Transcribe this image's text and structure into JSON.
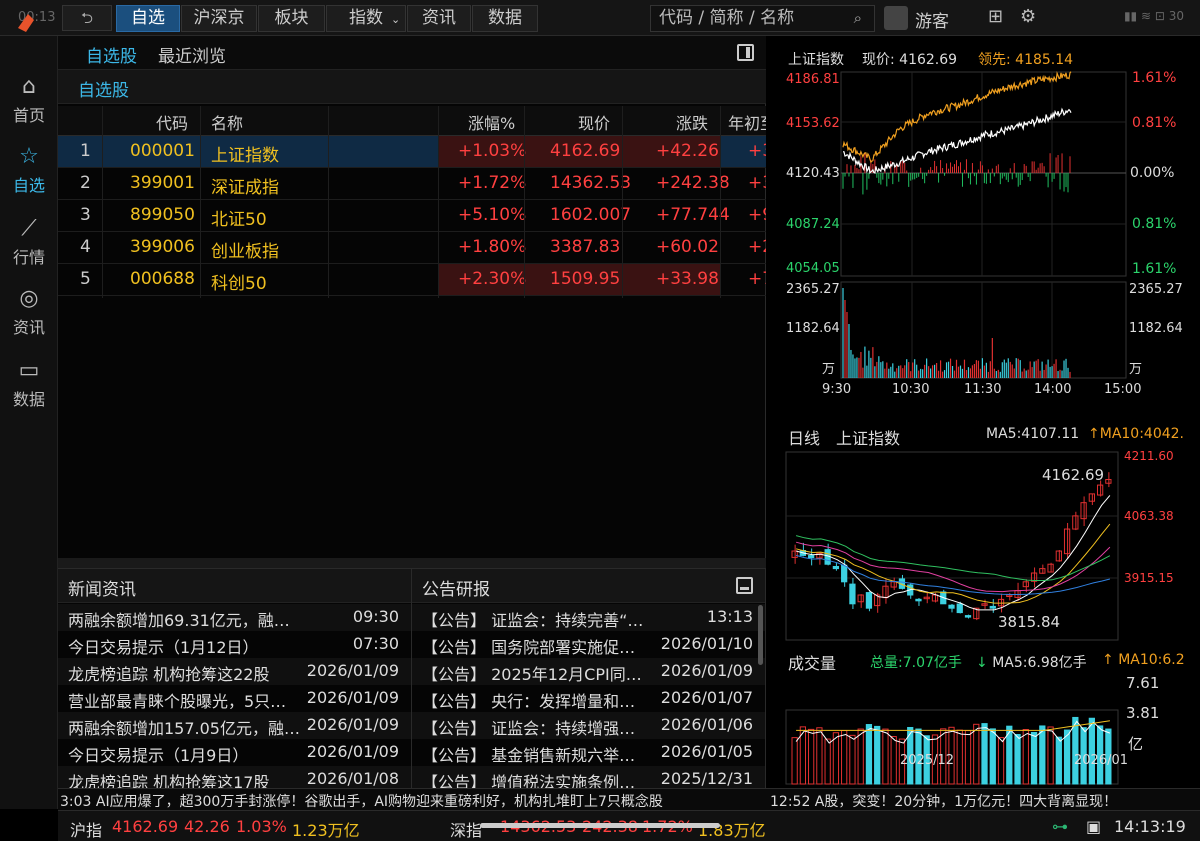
{
  "statusbar": {
    "time": "00:13",
    "battery": "30"
  },
  "topnav": {
    "back_icon": "back-arrow-icon",
    "tabs": [
      "自选",
      "沪深京",
      "板块",
      "指数",
      "资讯",
      "数据"
    ],
    "active_tab": "自选",
    "search_placeholder": "代码 / 简称 / 名称",
    "user": "游客"
  },
  "sidebar": {
    "items": [
      {
        "label": "首页",
        "icon": "home-icon"
      },
      {
        "label": "自选",
        "icon": "star-icon"
      },
      {
        "label": "行情",
        "icon": "chart-icon"
      },
      {
        "label": "资讯",
        "icon": "planet-icon"
      },
      {
        "label": "数据",
        "icon": "monitor-icon"
      }
    ]
  },
  "watchlist": {
    "tabs": [
      "自选股",
      "最近浏览"
    ],
    "group": "自选股",
    "headers": [
      "代码",
      "名称",
      "涨幅%",
      "现价",
      "涨跌",
      "年初至"
    ],
    "rows": [
      {
        "rank": "1",
        "code": "000001",
        "name": "上证指数",
        "pct": "+1.03%",
        "price": "4162.69",
        "chg": "+42.26",
        "ytd": "+3"
      },
      {
        "rank": "2",
        "code": "399001",
        "name": "深证成指",
        "pct": "+1.72%",
        "price": "14362.53",
        "chg": "+242.38",
        "ytd": "+3"
      },
      {
        "rank": "3",
        "code": "899050",
        "name": "北证50",
        "pct": "+5.10%",
        "price": "1602.007",
        "chg": "+77.744",
        "ytd": "+9"
      },
      {
        "rank": "4",
        "code": "399006",
        "name": "创业板指",
        "pct": "+1.80%",
        "price": "3387.83",
        "chg": "+60.02",
        "ytd": "+2"
      },
      {
        "rank": "5",
        "code": "000688",
        "name": "科创50",
        "pct": "+2.30%",
        "price": "1509.95",
        "chg": "+33.98",
        "ytd": "+7"
      }
    ]
  },
  "news": {
    "title": "新闻资讯",
    "items": [
      {
        "text": "两融余额增加69.31亿元，融…",
        "date": "09:30"
      },
      {
        "text": "今日交易提示（1月12日）",
        "date": "07:30"
      },
      {
        "text": "龙虎榜追踪 机构抢筹这22股",
        "date": "2026/01/09"
      },
      {
        "text": "营业部最青睐个股曝光，5只…",
        "date": "2026/01/09"
      },
      {
        "text": "两融余额增加157.05亿元，融…",
        "date": "2026/01/09"
      },
      {
        "text": "今日交易提示（1月9日）",
        "date": "2026/01/09"
      },
      {
        "text": "龙虎榜追踪 机构抢筹这17股",
        "date": "2026/01/08"
      }
    ]
  },
  "announcements": {
    "title": "公告研报",
    "items": [
      {
        "text": "【公告】 证监会：持续完善“…",
        "date": "13:13"
      },
      {
        "text": "【公告】 国务院部署实施促…",
        "date": "2026/01/10"
      },
      {
        "text": "【公告】 2025年12月CPI同…",
        "date": "2026/01/09"
      },
      {
        "text": "【公告】 央行：发挥增量和…",
        "date": "2026/01/07"
      },
      {
        "text": "【公告】 证监会：持续增强…",
        "date": "2026/01/06"
      },
      {
        "text": "【公告】 基金销售新规六举…",
        "date": "2026/01/05"
      },
      {
        "text": "【公告】 增值税法实施条例…",
        "date": "2025/12/31"
      }
    ]
  },
  "ticker": {
    "left": "3:03 AI应用爆了，超300万手封涨停！谷歌出手，AI购物迎来重磅利好，机构扎堆盯上7只概念股",
    "right": "12:52 A股，突变！20分钟，1万亿元！四大背离显现！"
  },
  "bottombar": {
    "sh_label": "沪指",
    "sh_price": "4162.69",
    "sh_chg": "42.26",
    "sh_pct": "1.03%",
    "sh_amt": "1.23万亿",
    "sz_label": "深指",
    "sz_price": "14362.53",
    "sz_chg": "242.38",
    "sz_pct": "1.72%",
    "sz_amt": "1.83万亿",
    "clock": "14:13:19"
  },
  "intraday": {
    "title": "上证指数",
    "price_label": "现价: 4162.69",
    "lead_label": "领先: 4185.14",
    "price_ticks": [
      "4186.81",
      "4153.62",
      "4120.43",
      "4087.24",
      "4054.05"
    ],
    "pct_ticks": [
      "1.61%",
      "0.81%",
      "0.00%",
      "0.81%",
      "1.61%"
    ],
    "vol_ticks": [
      "2365.27",
      "1182.64",
      "万"
    ],
    "time_ticks": [
      "9:30",
      "10:30",
      "11:30",
      "14:00",
      "15:00"
    ]
  },
  "daily": {
    "title": "日线",
    "name": "上证指数",
    "ma5": "MA5:4107.11",
    "ma10": "MA10:4042.",
    "price_ticks": [
      "4211.60",
      "4063.38",
      "3915.15"
    ],
    "high_label": "4162.69",
    "low_label": "3815.84"
  },
  "volume": {
    "title": "成交量",
    "total": "总量:7.07亿手",
    "ma5": "MA5:6.98亿手",
    "ma10": "MA10:6.2",
    "ticks": [
      "7.61",
      "3.81",
      "亿"
    ],
    "dates": [
      "2025/12",
      "2026/01"
    ]
  },
  "chart_data": [
    {
      "type": "line",
      "title": "上证指数",
      "x": [
        "9:30",
        "10:30",
        "11:30",
        "14:00",
        "15:00"
      ],
      "series": [
        {
          "name": "现价",
          "values": [
            4135,
            4128,
            4140,
            4150,
            4162.69
          ]
        },
        {
          "name": "领先",
          "values": [
            4140,
            4150,
            4165,
            4178,
            4185.14
          ]
        }
      ],
      "ylim": [
        4054.05,
        4186.81
      ]
    },
    {
      "type": "bar",
      "title": "成交量",
      "categories": [
        "2025/12",
        "2026/01"
      ],
      "ylim": [
        0,
        7.61
      ]
    }
  ]
}
